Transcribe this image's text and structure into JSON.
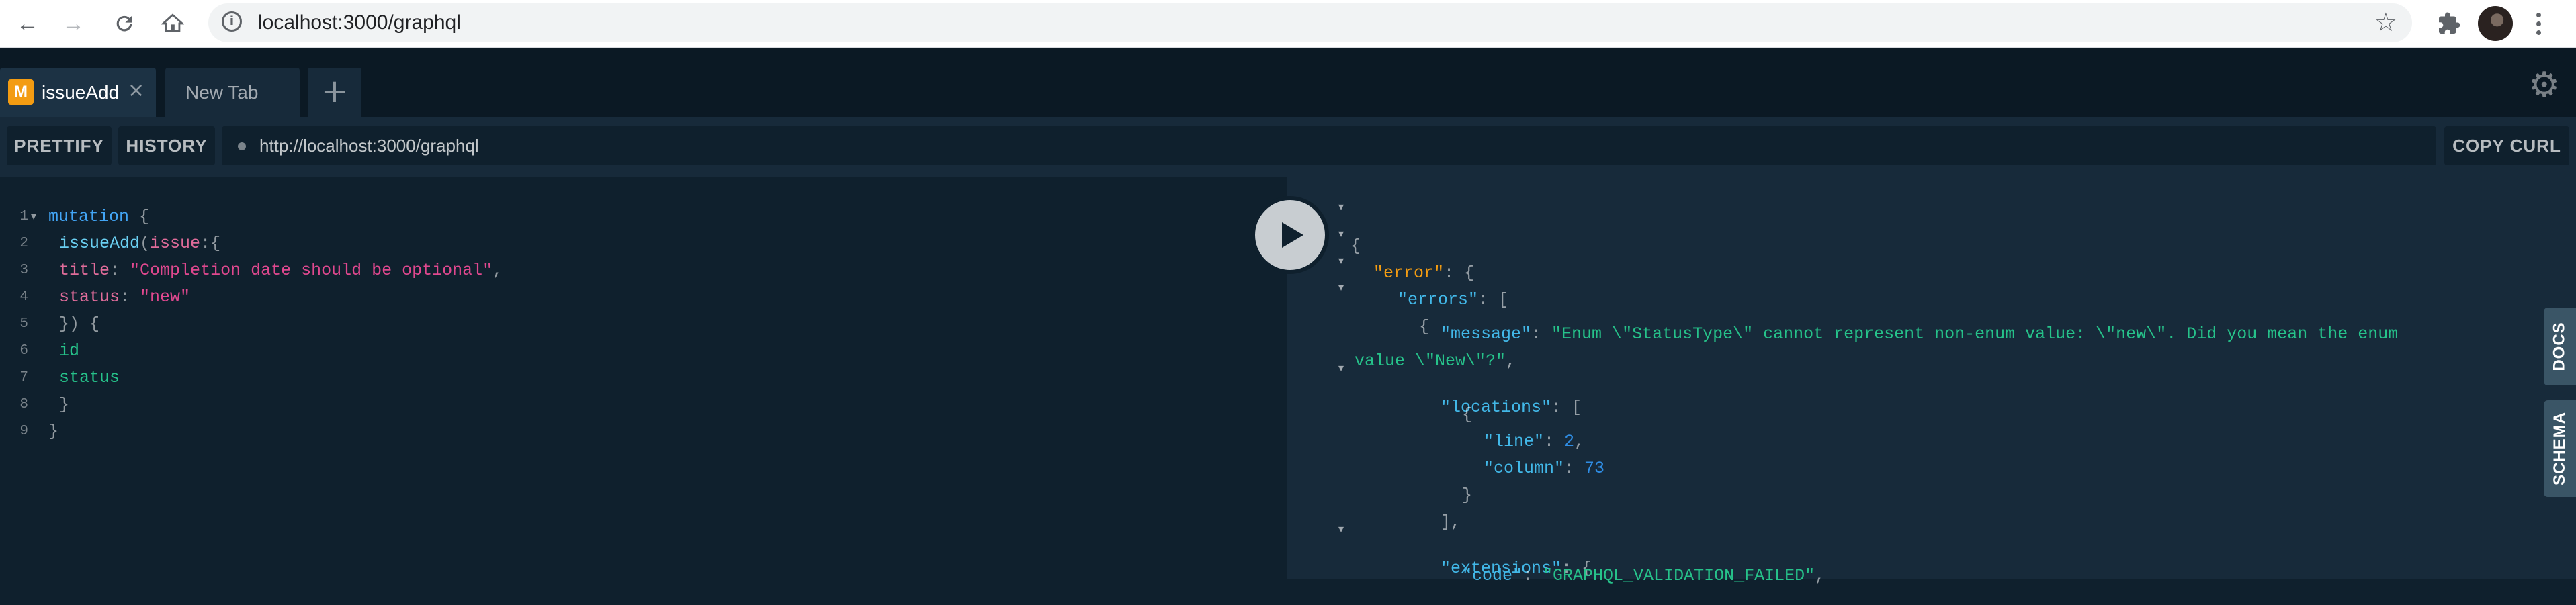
{
  "browser": {
    "url": "localhost:3000/graphql",
    "icons": [
      "back-arrow-icon",
      "forward-arrow-icon",
      "reload-icon",
      "home-icon",
      "info-icon",
      "star-icon",
      "extensions-icon",
      "profile-avatar",
      "more-menu-icon"
    ]
  },
  "tabs": [
    {
      "badge": "M",
      "label": "issueAdd",
      "active": true
    },
    {
      "label": "New Tab",
      "active": false
    }
  ],
  "toolbar": {
    "prettify": "PRETTIFY",
    "history": "HISTORY",
    "endpoint": "http://localhost:3000/graphql",
    "copy_curl": "COPY CURL"
  },
  "editor": {
    "line_numbers": [
      "1",
      "2",
      "3",
      "4",
      "5",
      "6",
      "7",
      "8",
      "9"
    ],
    "l1_kw": "mutation",
    "l1_brace": "{",
    "l2_fn": "issueAdd",
    "l2_paren": "(",
    "l2_arg": "issue",
    "l2_rest": ":{",
    "l3_key": "title",
    "l3_colon": ":",
    "l3_str": "\"Completion date should be optional\"",
    "l3_comma": ",",
    "l4_key": "status",
    "l4_colon": ":",
    "l4_str": "\"new\"",
    "l5": "}) {",
    "l6": "id",
    "l7": "status",
    "l8": "}",
    "l9": "}"
  },
  "result": {
    "open_brace": "{",
    "error_key": "\"error\"",
    "errors_key": "\"errors\"",
    "message_key": "\"message\"",
    "message_value_1": "\"Enum \\\"StatusType\\\" cannot represent non-enum value: \\\"new\\\". Did you mean the enum",
    "message_value_2": "value \\\"New\\\"?\"",
    "locations_key": "\"locations\"",
    "line_key": "\"line\"",
    "line_value": "2",
    "column_key": "\"column\"",
    "column_value": "73",
    "extensions_key": "\"extensions\"",
    "code_key": "\"code\"",
    "code_value": "\"GRAPHQL_VALIDATION_FAILED\""
  },
  "side_tabs": {
    "docs": "DOCS",
    "schema": "SCHEMA"
  },
  "colors": {
    "accent_badge": "#f39c12",
    "keyword": "#42a5f5",
    "string": "#e0488f",
    "field": "#26c28a",
    "json_key": "#42b8e8"
  }
}
